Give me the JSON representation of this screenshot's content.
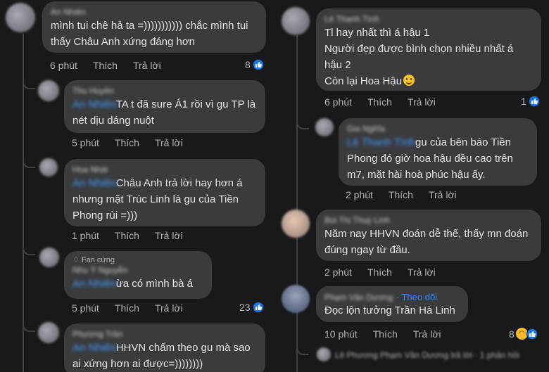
{
  "left": {
    "comments": [
      {
        "author": "An Nhiên",
        "text": "mình tui chê hả ta =))))))))))) chắc mình tui thấy Châu Anh xứng đáng hơn",
        "time": "6 phút",
        "like": "Thích",
        "reply": "Trả lời",
        "reactions": "8"
      },
      {
        "author": "Thu Huyền",
        "mention": "An Nhiên",
        "text": "TA t đã sure Á1 rồi vì gu TP là nét dịu dáng nuột",
        "time": "5 phút",
        "like": "Thích",
        "reply": "Trả lời"
      },
      {
        "author": "Hoa Nhài",
        "mention": "An Nhiên",
        "text": "Châu Anh trả lời hay hơn á nhưng mặt Trúc Linh là gu của Tiền Phong rùi =)))",
        "time": "1 phút",
        "like": "Thích",
        "reply": "Trả lời"
      },
      {
        "badge": "Fan cứng",
        "author": "Nhu Ý Nguyễn",
        "mention": "An Nhiên",
        "text": "ừa có mình bà á",
        "time": "5 phút",
        "like": "Thích",
        "reply": "Trả lời",
        "reactions": "23"
      },
      {
        "author": "Phương Trần",
        "mention": "An Nhiên",
        "text": "HHVN chấm theo gu mà sao ai xứng hơn ai được=))))))))",
        "time": "",
        "like": "",
        "reply": ""
      }
    ]
  },
  "right": {
    "comments": [
      {
        "author": "Lê Thanh Tình",
        "text_lines": [
          "Tl hay nhất thì á hậu 1",
          "Người đẹp được bình chọn nhiều nhất á hậu 2",
          "Còn lại Hoa Hậu"
        ],
        "time": "6 phút",
        "like": "Thích",
        "reply": "Trả lời",
        "reactions": "1"
      },
      {
        "author": "Gia Nghĩa",
        "mention": "Lê Thanh Tình",
        "text": "gu của bên báo Tiền Phong đó giờ hoa hậu đều cao trên m7, mặt hài hoà phúc hậu ấy.",
        "time": "2 phút",
        "like": "Thích",
        "reply": "Trả lời"
      },
      {
        "author": "Bùi Thị Thuỳ Linh",
        "text": "Năm nay HHVN đoán dễ thế, thấy mn đoán đúng ngay từ đầu.",
        "time": "2 phút",
        "like": "Thích",
        "reply": "Trả lời"
      },
      {
        "author": "Phạm Văn Dương",
        "follow": "Theo dõi",
        "text": "Đọc lộn tưởng Trần Hà Linh",
        "time": "10 phút",
        "like": "Thích",
        "reply": "Trả lời",
        "reactions": "8"
      },
      {
        "author": "Lê Phương",
        "preview": "Phạm Văn Dương trả lời · 1 phản hồi"
      }
    ]
  },
  "colors": {
    "background": "#18191a",
    "bubble": "#3a3b3c",
    "meta": "#b0b3b8",
    "mention": "#4599ff",
    "like_blue": "#1877f2",
    "haha_yellow": "#f7b928"
  },
  "icons": [
    "like-icon",
    "haha-icon",
    "smile-emoji-icon",
    "fan-badge-icon"
  ]
}
